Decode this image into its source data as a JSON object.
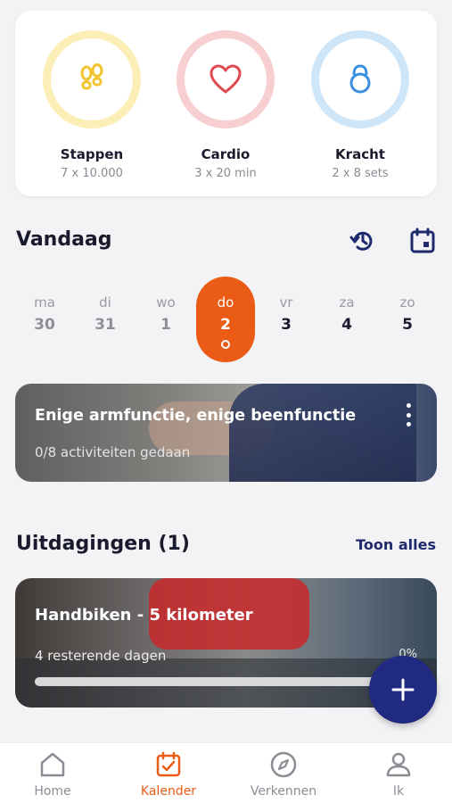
{
  "goals": [
    {
      "title": "Stappen",
      "sub": "7 x 10.000",
      "icon": "footprints-icon",
      "ring_color": "#fbeeb6",
      "icon_color": "#f4c430"
    },
    {
      "title": "Cardio",
      "sub": "3 x 20 min",
      "icon": "heart-icon",
      "ring_color": "#f7cfd1",
      "icon_color": "#e04a4f"
    },
    {
      "title": "Kracht",
      "sub": "2 x 8 sets",
      "icon": "kettlebell-icon",
      "ring_color": "#cfe5f8",
      "icon_color": "#3b8fe0"
    }
  ],
  "today": {
    "title": "Vandaag",
    "days": [
      {
        "name": "ma",
        "date": "30"
      },
      {
        "name": "di",
        "date": "31"
      },
      {
        "name": "wo",
        "date": "1"
      },
      {
        "name": "do",
        "date": "2",
        "active": true
      },
      {
        "name": "vr",
        "date": "3"
      },
      {
        "name": "za",
        "date": "4"
      },
      {
        "name": "zo",
        "date": "5"
      }
    ]
  },
  "activity": {
    "title": "Enige armfunctie, enige beenfunctie",
    "sub": "0/8 activiteiten gedaan"
  },
  "challenges": {
    "title": "Uitdagingen (1)",
    "link": "Toon alles",
    "card": {
      "title": "Handbiken - 5 kilometer",
      "sub": "4 resterende dagen",
      "percent": "0%",
      "progress": 0
    }
  },
  "nav": [
    {
      "label": "Home",
      "icon": "home-icon"
    },
    {
      "label": "Kalender",
      "icon": "calendar-check-icon",
      "active": true
    },
    {
      "label": "Verkennen",
      "icon": "compass-icon"
    },
    {
      "label": "Ik",
      "icon": "user-icon"
    }
  ],
  "colors": {
    "accent": "#ea5b16",
    "primary": "#1f2a6e"
  }
}
